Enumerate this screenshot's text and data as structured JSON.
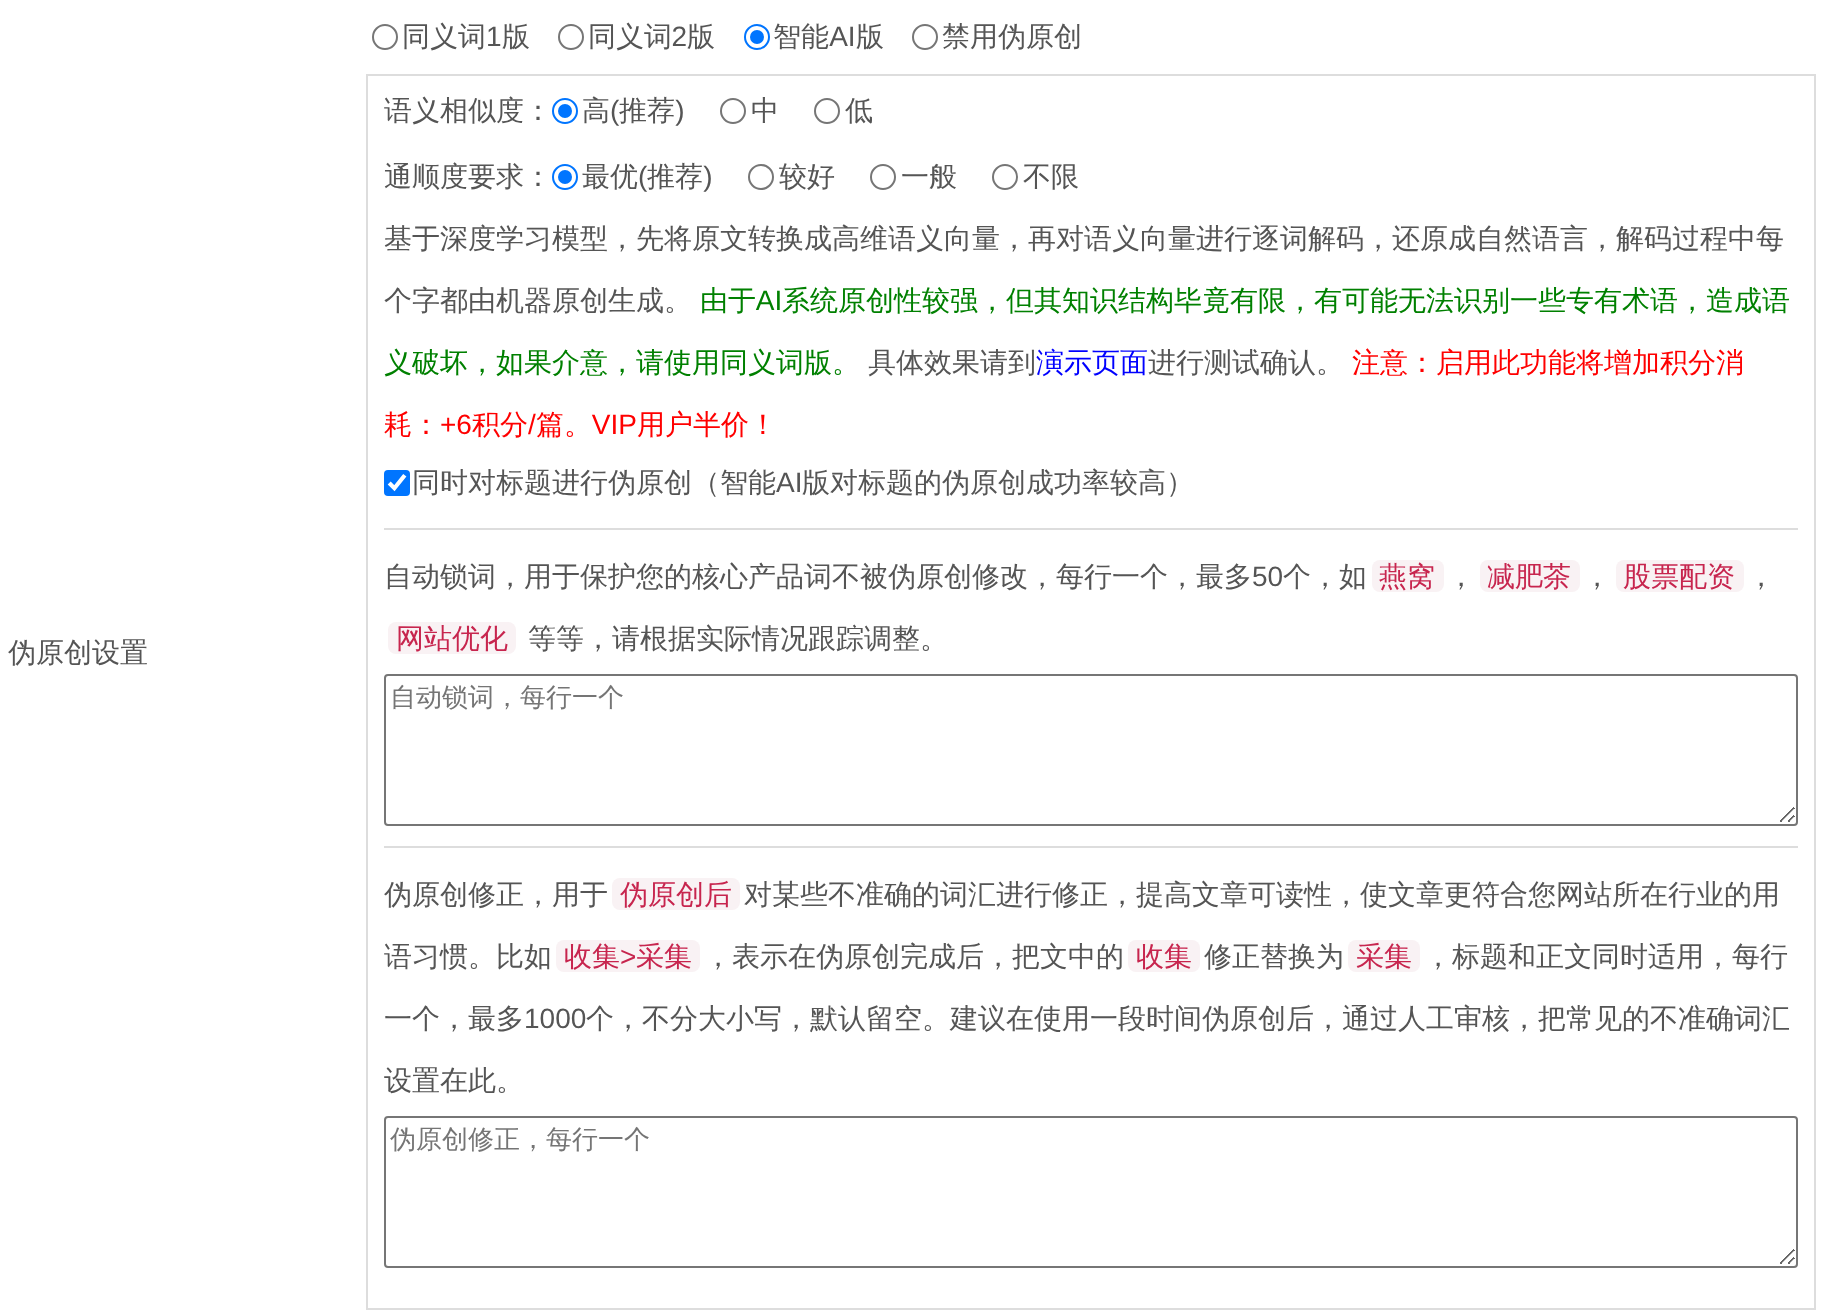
{
  "modes": [
    {
      "label": "同义词1版",
      "selected": false
    },
    {
      "label": "同义词2版",
      "selected": false
    },
    {
      "label": "智能AI版",
      "selected": true
    },
    {
      "label": "禁用伪原创",
      "selected": false
    }
  ],
  "option_groups": [
    {
      "label": "语义相似度：",
      "options": [
        {
          "label": "高(推荐)",
          "selected": true
        },
        {
          "label": "中",
          "selected": false
        },
        {
          "label": "低",
          "selected": false
        }
      ]
    },
    {
      "label": "通顺度要求：",
      "options": [
        {
          "label": "最优(推荐)",
          "selected": true
        },
        {
          "label": "较好",
          "selected": false
        },
        {
          "label": "一般",
          "selected": false
        },
        {
          "label": "不限",
          "selected": false
        }
      ]
    }
  ],
  "ai_note": [
    {
      "kind": "plain",
      "text": "基于深度学习模型，先将原文转换成高维语义向量，再对语义向量进行逐词解码，还原成自然语言，解码过程中每个字都由机器原创生成。 "
    },
    {
      "kind": "green",
      "text": "由于AI系统原创性较强，但其知识结构毕竟有限，有可能无法识别一些专有术语，造成语义破坏，如果介意，请使用同义词版。"
    },
    {
      "kind": "plain",
      "text": " 具体效果请到"
    },
    {
      "kind": "link",
      "text": "演示页面"
    },
    {
      "kind": "plain",
      "text": "进行测试确认。 "
    },
    {
      "kind": "red",
      "text": "注意：启用此功能将增加积分消耗：+6积分/篇。VIP用户半价！"
    }
  ],
  "title_checkbox": {
    "label": "同时对标题进行伪原创（智能AI版对标题的伪原创成功率较高）",
    "checked": true
  },
  "side_label": "伪原创设置",
  "sections": [
    {
      "description": [
        {
          "kind": "plain",
          "text": "自动锁词，用于保护您的核心产品词不被伪原创修改，每行一个，最多50个，如"
        },
        {
          "kind": "tag",
          "text": "燕窝"
        },
        {
          "kind": "plain",
          "text": "，"
        },
        {
          "kind": "tag",
          "text": "减肥茶"
        },
        {
          "kind": "plain",
          "text": "，"
        },
        {
          "kind": "tag",
          "text": "股票配资"
        },
        {
          "kind": "plain",
          "text": "，"
        },
        {
          "kind": "tag",
          "text": "网站优化"
        },
        {
          "kind": "plain",
          "text": " 等等，请根据实际情况跟踪调整。"
        }
      ],
      "placeholder": "自动锁词，每行一个"
    },
    {
      "description": [
        {
          "kind": "plain",
          "text": "伪原创修正，用于"
        },
        {
          "kind": "tag",
          "text": "伪原创后"
        },
        {
          "kind": "plain",
          "text": "对某些不准确的词汇进行修正，提高文章可读性，使文章更符合您网站所在行业的用语习惯。比如"
        },
        {
          "kind": "tag",
          "text": "收集>采集"
        },
        {
          "kind": "plain",
          "text": "，表示在伪原创完成后，把文中的"
        },
        {
          "kind": "tag",
          "text": "收集"
        },
        {
          "kind": "plain",
          "text": "修正替换为"
        },
        {
          "kind": "tag",
          "text": "采集"
        },
        {
          "kind": "plain",
          "text": "，标题和正文同时适用，每行一个，最多1000个，不分大小写，默认留空。建议在使用一段时间伪原创后，通过人工审核，把常见的不准确词汇设置在此。"
        }
      ],
      "placeholder": "伪原创修正，每行一个"
    }
  ]
}
